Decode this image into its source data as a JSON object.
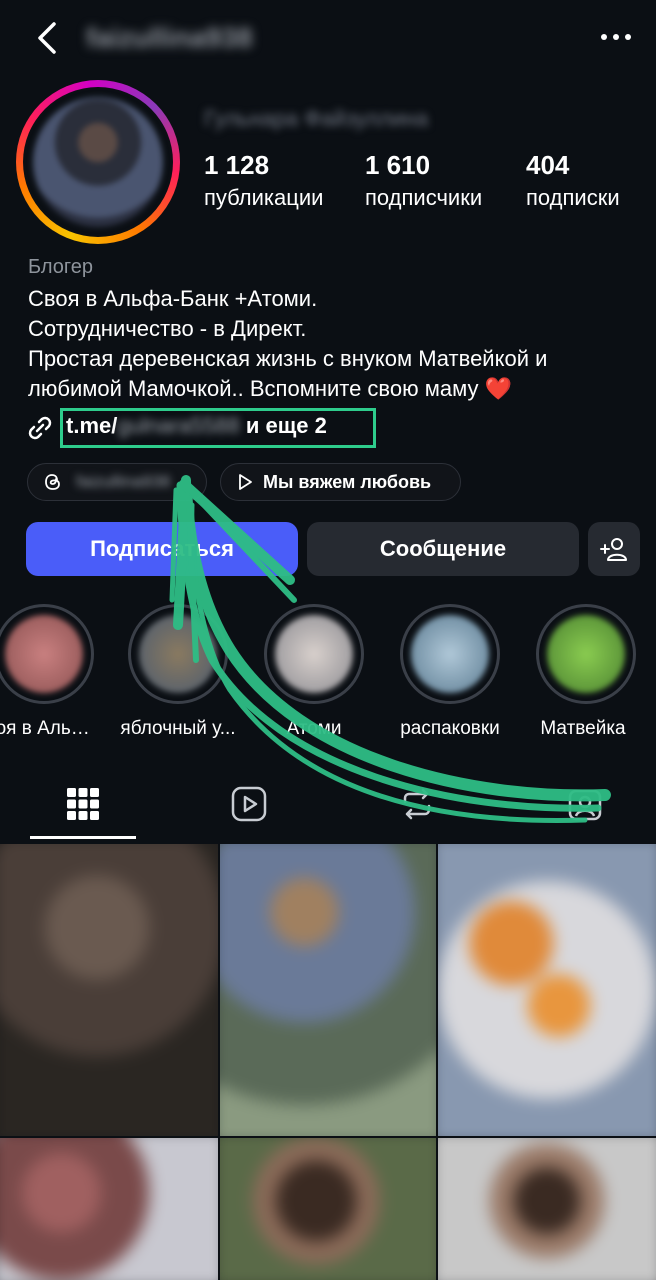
{
  "header": {
    "username": "faizullina938",
    "fullname": "Гульнара Файзуллина"
  },
  "stats": [
    {
      "value": "1 128",
      "label": "публикации"
    },
    {
      "value": "1 610",
      "label": "подписчики"
    },
    {
      "value": "404",
      "label": "подписки"
    }
  ],
  "bio": {
    "category": "Блогер",
    "line1": "Своя в Альфа-Банк +Атоми.",
    "line2": "Сотрудничество - в Директ.",
    "line3": "Простая деревенская жизнь с внуком Матвейкой и",
    "line4": "любимой Мамочкой.. Вспомните свою маму",
    "heart": "❤️",
    "link_prefix": "t.me/",
    "link_hidden": "gulnara5588",
    "link_suffix": " и еще 2"
  },
  "chips": {
    "threads_handle": "faizullina938",
    "reel_label": "Мы вяжем любовь"
  },
  "buttons": {
    "follow": "Подписаться",
    "message": "Сообщение"
  },
  "highlights": [
    {
      "label": "Своя в Альфа-Банк",
      "color": "#b86a6a"
    },
    {
      "label": "яблочный у...",
      "color": "#6a5a48"
    },
    {
      "label": "Атоми",
      "color": "#c9c4c0"
    },
    {
      "label": "распаковки",
      "color": "#7aa0c0"
    },
    {
      "label": "Матвейка",
      "color": "#6aa040"
    }
  ],
  "tabs": [
    "grid-icon",
    "reels-icon",
    "reposts-icon",
    "tagged-icon"
  ],
  "colors": {
    "accent": "#4a5df9",
    "annotation": "#2ecc8c",
    "background": "#0b0f14"
  }
}
